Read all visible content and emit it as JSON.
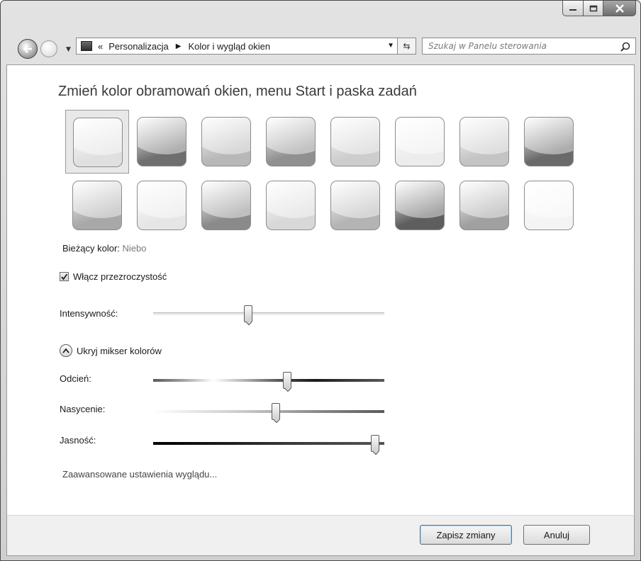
{
  "window": {
    "controls": {
      "minimize": "minimize",
      "maximize": "maximize",
      "close": "close"
    }
  },
  "navigation": {
    "breadcrumb": [
      "Personalizacja",
      "Kolor i wygląd okien"
    ],
    "overflow_marker": "«",
    "search_placeholder": "Szukaj w Panelu sterowania"
  },
  "page": {
    "title": "Zmień kolor obramowań okien, menu Start i paska zadań",
    "current_color_label": "Bieżący kolor:",
    "current_color_value": "Niebo",
    "transparency_label": "Włącz przezroczystość",
    "transparency_checked": true,
    "intensity_label": "Intensywność:",
    "intensity_fraction": 0.41,
    "hide_mixer_label": "Ukryj mikser kolorów",
    "hue_label": "Odcień:",
    "hue_fraction": 0.58,
    "saturation_label": "Nasycenie:",
    "saturation_fraction": 0.53,
    "brightness_label": "Jasność:",
    "brightness_fraction": 0.96,
    "advanced_link": "Zaawansowane ustawienia wyglądu..."
  },
  "swatches": [
    {
      "color": "#e0e0e0",
      "selected": true
    },
    {
      "color": "#6f6f6f"
    },
    {
      "color": "#b8b8b8"
    },
    {
      "color": "#909090"
    },
    {
      "color": "#cdcdcd"
    },
    {
      "color": "#ececec"
    },
    {
      "color": "#c4c4c4"
    },
    {
      "color": "#6a6a6a"
    },
    {
      "color": "#a8a8a8"
    },
    {
      "color": "#e6e6e6"
    },
    {
      "color": "#8a8a8a"
    },
    {
      "color": "#d8d8d8"
    },
    {
      "color": "#b4b4b4"
    },
    {
      "color": "#5e5e5e"
    },
    {
      "color": "#a0a0a0"
    },
    {
      "color": "#f4f4f4"
    }
  ],
  "footer": {
    "save_label": "Zapisz zmiany",
    "cancel_label": "Anuluj"
  }
}
